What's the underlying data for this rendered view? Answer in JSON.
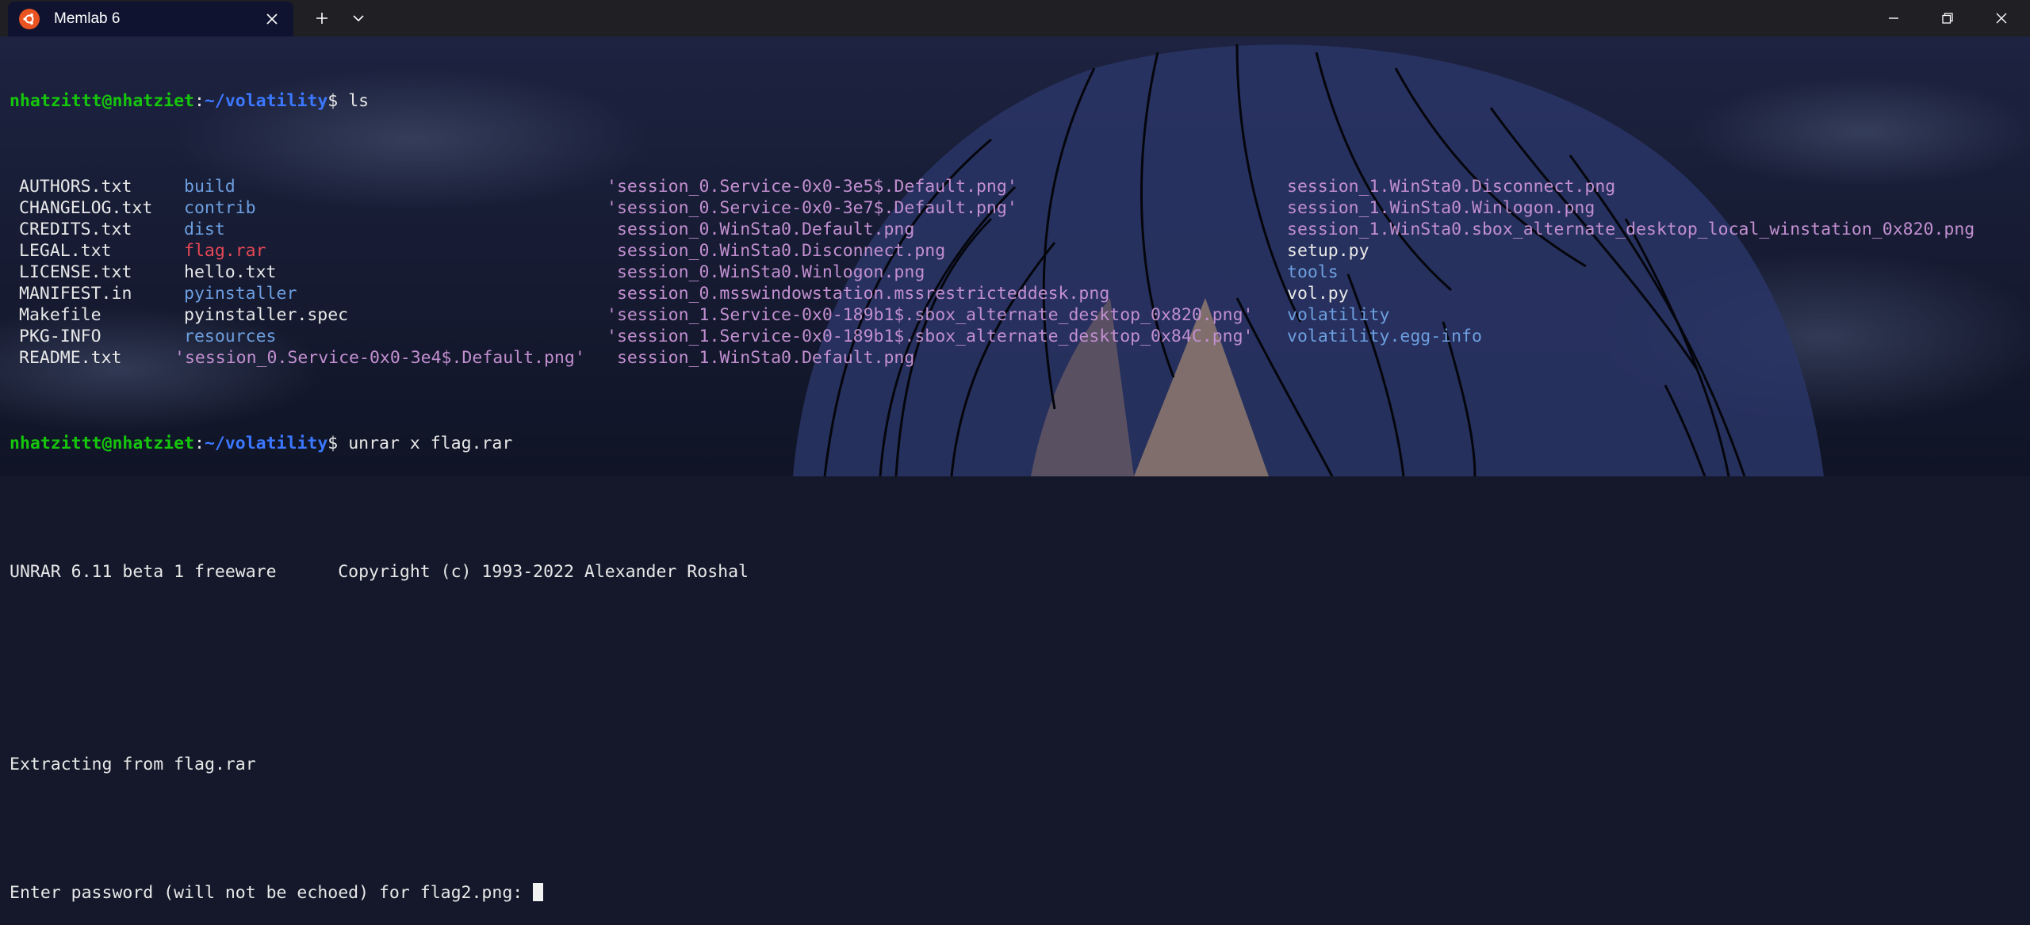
{
  "window": {
    "tab_title": "Memlab 6",
    "tab_icon": "ubuntu-icon",
    "accent": "#e95420"
  },
  "prompt": {
    "user_host": "nhatzittt@nhatziet",
    "path": "~/volatility"
  },
  "commands": {
    "ls": "ls",
    "unrar": "unrar x flag.rar"
  },
  "ls_output": {
    "col1": [
      "AUTHORS.txt",
      "CHANGELOG.txt",
      "CREDITS.txt",
      "LEGAL.txt",
      "LICENSE.txt",
      "MANIFEST.in",
      "Makefile",
      "PKG-INFO",
      "README.txt"
    ],
    "col2": [
      {
        "name": "build",
        "type": "dir"
      },
      {
        "name": "contrib",
        "type": "dir"
      },
      {
        "name": "dist",
        "type": "dir"
      },
      {
        "name": "flag.rar",
        "type": "archive"
      },
      {
        "name": "hello.txt",
        "type": "file"
      },
      {
        "name": "pyinstaller",
        "type": "dir"
      },
      {
        "name": "pyinstaller.spec",
        "type": "file"
      },
      {
        "name": "resources",
        "type": "dir"
      },
      {
        "name": "'session_0.Service-0x0-3e4$.Default.png'",
        "type": "image"
      }
    ],
    "col3": [
      "'session_0.Service-0x0-3e5$.Default.png'",
      "'session_0.Service-0x0-3e7$.Default.png'",
      " session_0.WinSta0.Default.png",
      " session_0.WinSta0.Disconnect.png",
      " session_0.WinSta0.Winlogon.png",
      " session_0.msswindowstation.mssrestricteddesk.png",
      "'session_1.Service-0x0-189b1$.sbox_alternate_desktop_0x820.png'",
      "'session_1.Service-0x0-189b1$.sbox_alternate_desktop_0x84C.png'",
      " session_1.WinSta0.Default.png"
    ],
    "col4": [
      {
        "name": "session_1.WinSta0.Disconnect.png",
        "type": "image"
      },
      {
        "name": "session_1.WinSta0.Winlogon.png",
        "type": "image"
      },
      {
        "name": "session_1.WinSta0.sbox_alternate_desktop_local_winstation_0x820.png",
        "type": "image"
      },
      {
        "name": "setup.py",
        "type": "file"
      },
      {
        "name": "tools",
        "type": "dir"
      },
      {
        "name": "vol.py",
        "type": "file"
      },
      {
        "name": "volatility",
        "type": "dir"
      },
      {
        "name": "volatility.egg-info",
        "type": "dir"
      }
    ]
  },
  "output": {
    "unrar_banner": "UNRAR 6.11 beta 1 freeware      Copyright (c) 1993-2022 Alexander Roshal",
    "extracting": "Extracting from flag.rar",
    "password_prompt": "Enter password (will not be echoed) for flag2.png: "
  },
  "colors": {
    "prompt_user": "#16c60c",
    "prompt_path": "#3b78ff",
    "directory": "#6d9fe0",
    "archive": "#e74856",
    "image": "#c28fd0",
    "text": "#e8e8e8"
  }
}
